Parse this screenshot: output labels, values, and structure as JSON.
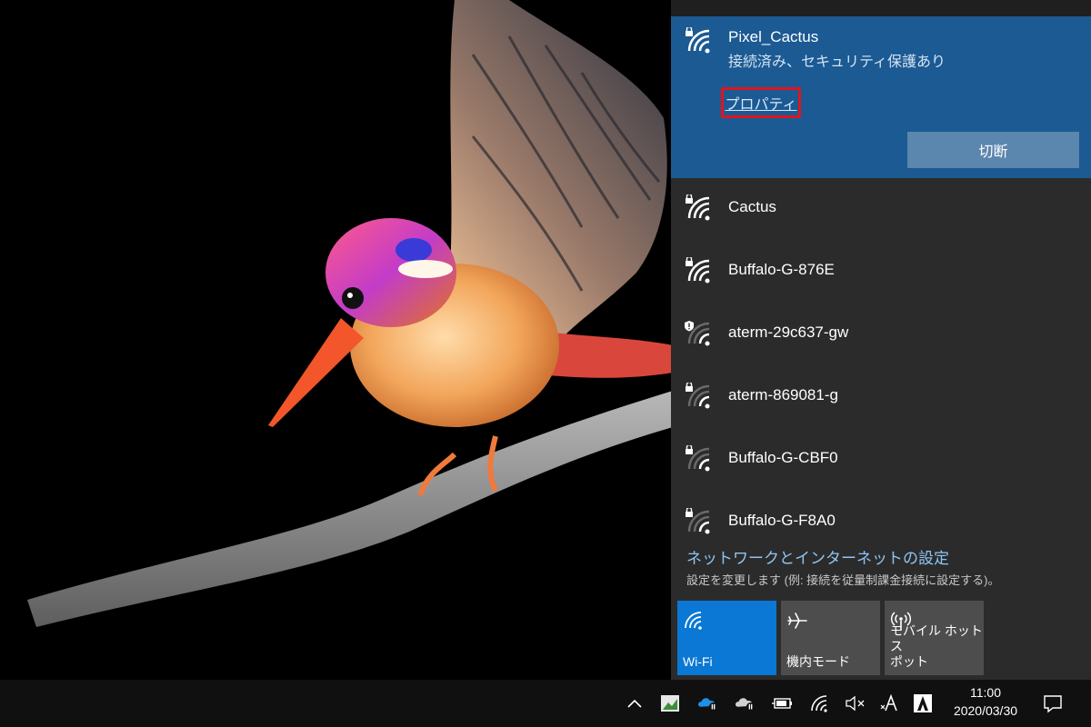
{
  "flyout": {
    "connected": {
      "ssid": "Pixel_Cactus",
      "status": "接続済み、セキュリティ保護あり",
      "properties_link": "プロパティ",
      "disconnect_label": "切断"
    },
    "networks": [
      {
        "ssid": "Cactus",
        "secured": true,
        "shield": false,
        "signal": "full"
      },
      {
        "ssid": "Buffalo-G-876E",
        "secured": true,
        "shield": false,
        "signal": "full"
      },
      {
        "ssid": "aterm-29c637-gw",
        "secured": false,
        "shield": true,
        "signal": "weak"
      },
      {
        "ssid": "aterm-869081-g",
        "secured": true,
        "shield": false,
        "signal": "weak"
      },
      {
        "ssid": "Buffalo-G-CBF0",
        "secured": true,
        "shield": false,
        "signal": "weak"
      },
      {
        "ssid": "Buffalo-G-F8A0",
        "secured": true,
        "shield": false,
        "signal": "weak"
      }
    ],
    "settings_link": "ネットワークとインターネットの設定",
    "settings_desc": "設定を変更します (例: 接続を従量制課金接続に設定する)。",
    "quick_actions": {
      "wifi_label": "Wi-Fi",
      "airplane_label": "機内モード",
      "hotspot_label_line1": "モバイル ホットス",
      "hotspot_label_line2": "ポット"
    }
  },
  "taskbar": {
    "tray_icons": [
      "chevron-up-icon",
      "app-thumbnail-icon",
      "onedrive-paused-icon",
      "onedrive-paused-gray-icon",
      "battery-icon",
      "wifi-icon",
      "volume-muted-icon",
      "ime-a-icon",
      "adobe-icon"
    ],
    "time": "11:00",
    "date": "2020/03/30"
  },
  "colors": {
    "connected_bg": "#1b5a93",
    "flyout_bg": "#2b2b2b",
    "accent": "#0a78d4",
    "highlight_box": "#e0141e",
    "link": "#8fc5f2"
  }
}
